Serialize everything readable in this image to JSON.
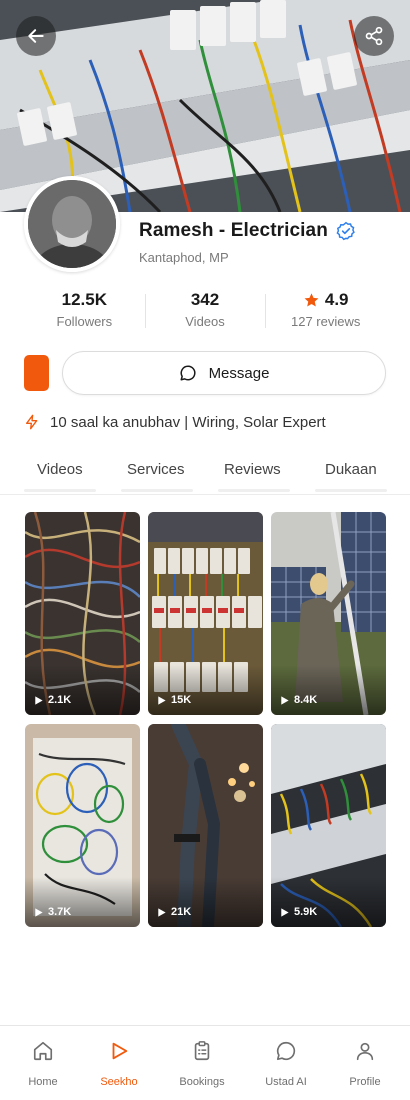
{
  "profile": {
    "name": "Ramesh - Electrician",
    "location": "Kantaphod, MP",
    "bio": "10 saal ka anubhav | Wiring, Solar Expert",
    "verified": true
  },
  "stats": [
    {
      "value": "12.5K",
      "label": "Followers"
    },
    {
      "value": "342",
      "label": "Videos"
    },
    {
      "value": "4.9",
      "label": "127 reviews",
      "icon": "star-icon"
    }
  ],
  "actions": {
    "message_label": "Message"
  },
  "tabs": [
    {
      "label": "Videos"
    },
    {
      "label": "Services"
    },
    {
      "label": "Reviews"
    },
    {
      "label": "Dukaan"
    }
  ],
  "videos": [
    {
      "views": "2.1K"
    },
    {
      "views": "15K"
    },
    {
      "views": "8.4K"
    },
    {
      "views": "3.7K"
    },
    {
      "views": "21K"
    },
    {
      "views": "5.9K"
    }
  ],
  "nav": [
    {
      "label": "Home",
      "icon": "home-icon"
    },
    {
      "label": "Seekho",
      "icon": "play-icon",
      "active": true
    },
    {
      "label": "Bookings",
      "icon": "clipboard-icon"
    },
    {
      "label": "Ustad AI",
      "icon": "chat-icon"
    },
    {
      "label": "Profile",
      "icon": "person-icon"
    }
  ],
  "colors": {
    "accent": "#f15a0d",
    "verified": "#2f80ed",
    "text": "#1a1a1a",
    "muted": "#7a7a7a"
  }
}
